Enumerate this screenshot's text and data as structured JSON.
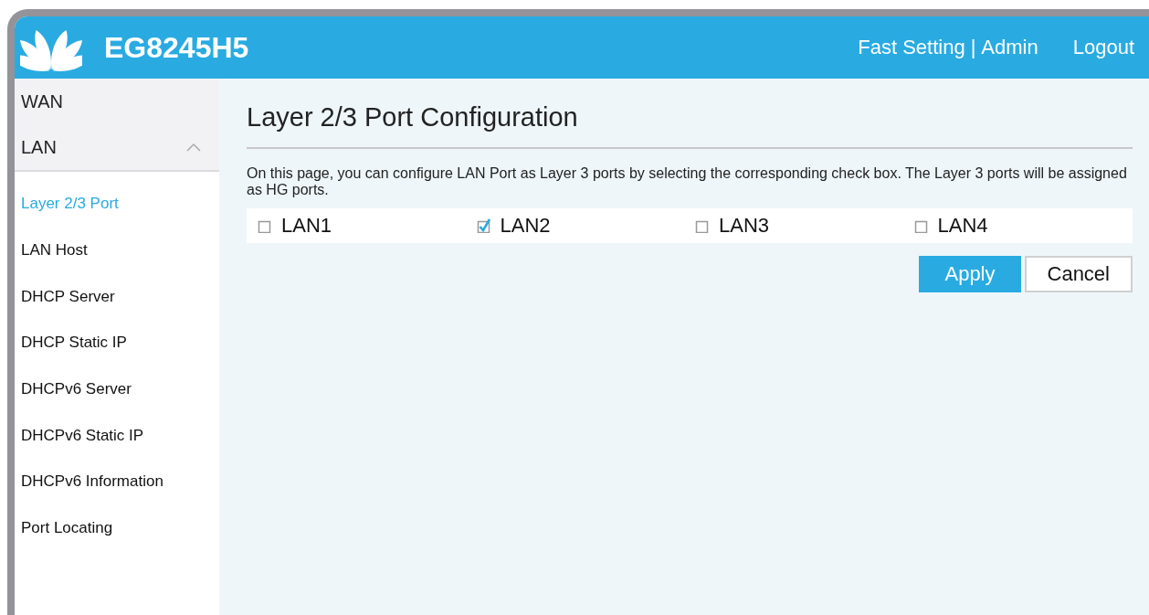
{
  "header": {
    "title": "EG8245H5",
    "links": [
      {
        "label": "Fast Setting"
      },
      {
        "label": "Admin"
      }
    ],
    "separator": "|",
    "logout": "Logout"
  },
  "sidebar": {
    "items": [
      {
        "label": "WAN"
      },
      {
        "label": "LAN",
        "expanded": true,
        "children": [
          {
            "label": "Layer 2/3 Port",
            "selected": true
          },
          {
            "label": "LAN Host",
            "selected": false
          },
          {
            "label": "DHCP Server",
            "selected": false
          },
          {
            "label": "DHCP Static IP",
            "selected": false
          },
          {
            "label": "DHCPv6 Server",
            "selected": false
          },
          {
            "label": "DHCPv6 Static IP",
            "selected": false
          },
          {
            "label": "DHCPv6 Information",
            "selected": false
          },
          {
            "label": "Port Locating",
            "selected": false
          }
        ]
      }
    ]
  },
  "main": {
    "title": "Layer 2/3 Port Configuration",
    "description": "On this page, you can configure LAN Port as Layer 3 ports by selecting the corresponding check box. The Layer 3 ports will be assigned as HG ports.",
    "ports": [
      {
        "label": "LAN1",
        "checked": false
      },
      {
        "label": "LAN2",
        "checked": true
      },
      {
        "label": "LAN3",
        "checked": false
      },
      {
        "label": "LAN4",
        "checked": false
      }
    ],
    "buttons": [
      {
        "label": "Apply",
        "kind": "primary"
      },
      {
        "label": "Cancel",
        "kind": "secondary"
      }
    ]
  }
}
